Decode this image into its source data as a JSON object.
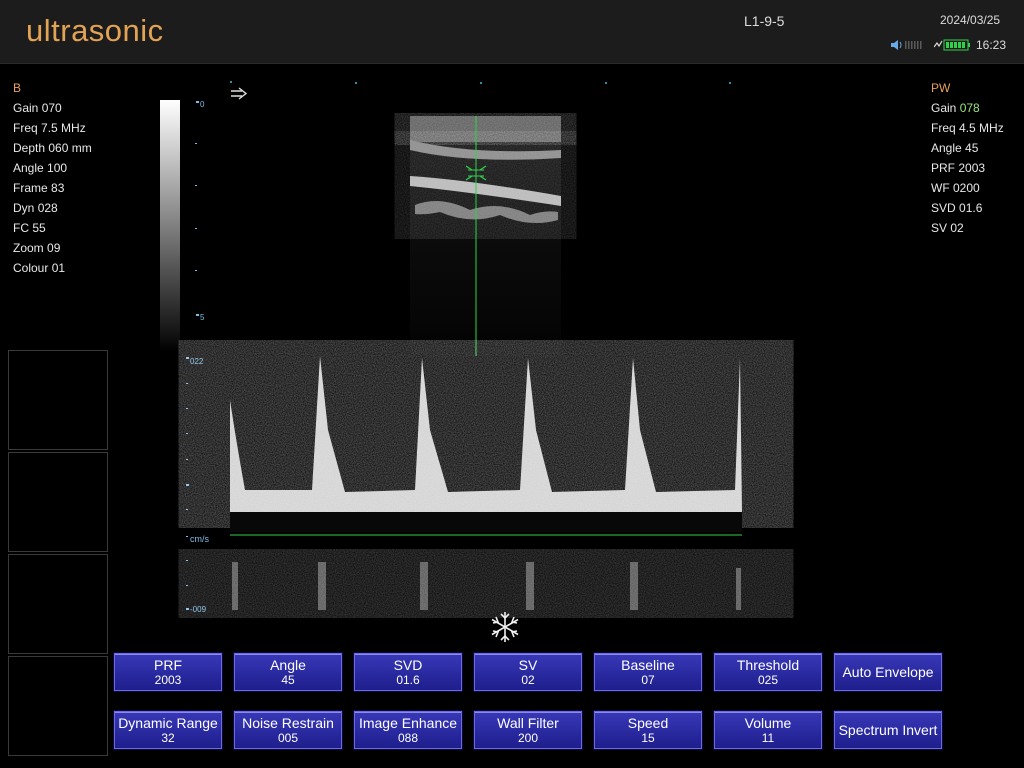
{
  "header": {
    "brand": "ultrasonic",
    "probe": "L1-9-5",
    "date": "2024/03/25",
    "time": "16:23"
  },
  "left_panel": {
    "mode": "B",
    "params": [
      {
        "label": "Gain",
        "value": "070"
      },
      {
        "label": "Freq",
        "value": "7.5 MHz"
      },
      {
        "label": "Depth",
        "value": "060 mm"
      },
      {
        "label": "Angle",
        "value": "100"
      },
      {
        "label": "Frame",
        "value": "83"
      },
      {
        "label": "Dyn",
        "value": "028"
      },
      {
        "label": "FC",
        "value": "55"
      },
      {
        "label": "Zoom",
        "value": "09"
      },
      {
        "label": "Colour",
        "value": "01"
      }
    ]
  },
  "right_panel": {
    "mode": "PW",
    "params": [
      {
        "label": "Gain",
        "value": "078"
      },
      {
        "label": "Freq",
        "value": "4.5 MHz"
      },
      {
        "label": "Angle",
        "value": "45"
      },
      {
        "label": "PRF",
        "value": "2003"
      },
      {
        "label": "WF",
        "value": "0200"
      },
      {
        "label": "SVD",
        "value": "01.6"
      },
      {
        "label": "SV",
        "value": "02"
      }
    ]
  },
  "depth_scale": {
    "top": "0",
    "bottom": "5"
  },
  "spectrum_scale": {
    "top": "022",
    "unit": "cm/s",
    "bottom": "-009"
  },
  "colors": {
    "accent": "#e2a354",
    "button": "#2a2aa6",
    "sample_line": "#2fd24a"
  },
  "buttons_row1": [
    {
      "label": "PRF",
      "value": "2003"
    },
    {
      "label": "Angle",
      "value": "45"
    },
    {
      "label": "SVD",
      "value": "01.6"
    },
    {
      "label": "SV",
      "value": "02"
    },
    {
      "label": "Baseline",
      "value": "07"
    },
    {
      "label": "Threshold",
      "value": "025"
    },
    {
      "label": "Auto Envelope",
      "value": ""
    }
  ],
  "buttons_row2": [
    {
      "label": "Dynamic Range",
      "value": "32"
    },
    {
      "label": "Noise Restrain",
      "value": "005"
    },
    {
      "label": "Image Enhance",
      "value": "088"
    },
    {
      "label": "Wall Filter",
      "value": "200"
    },
    {
      "label": "Speed",
      "value": "15"
    },
    {
      "label": "Volume",
      "value": "11"
    },
    {
      "label": "Spectrum Invert",
      "value": ""
    }
  ],
  "icons": {
    "freeze": "snowflake-icon",
    "arrow": "arrow-right-icon",
    "speaker": "speaker-icon",
    "battery": "battery-icon"
  }
}
